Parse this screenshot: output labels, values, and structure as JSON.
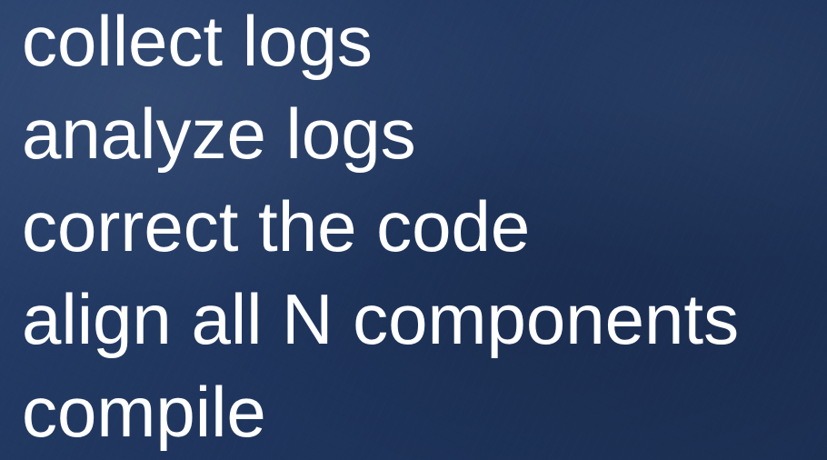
{
  "slide": {
    "lines": [
      "collect logs",
      "analyze logs",
      "correct the code",
      "align all N components",
      "compile"
    ]
  },
  "colors": {
    "background": "#203760",
    "text": "#ffffff"
  }
}
